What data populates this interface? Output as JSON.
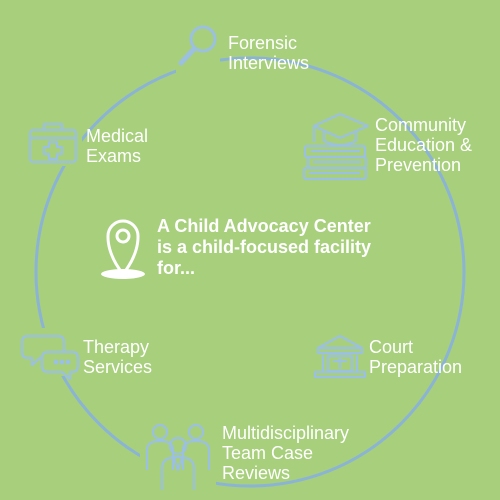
{
  "center": {
    "text": "A Child Advocacy Center\nis a child-focused facility\nfor...",
    "icon": "location-pin-icon"
  },
  "nodes": [
    {
      "id": "forensic-interviews",
      "label": "Forensic\nInterviews",
      "icon": "magnifying-glass-icon"
    },
    {
      "id": "community-education",
      "label": "Community\nEducation &\nPrevention",
      "icon": "graduation-cap-books-icon"
    },
    {
      "id": "court-preparation",
      "label": "Court\nPreparation",
      "icon": "courthouse-icon"
    },
    {
      "id": "multidisciplinary-team",
      "label": "Multidisciplinary\nTeam Case\nReviews",
      "icon": "team-people-icon"
    },
    {
      "id": "therapy-services",
      "label": "Therapy\nServices",
      "icon": "speech-bubbles-icon"
    },
    {
      "id": "medical-exams",
      "label": "Medical\nExams",
      "icon": "medical-kit-icon"
    }
  ],
  "colors": {
    "background": "#a7cf7c",
    "ring": "#8bb3d6",
    "icon_stroke": "#9cc0e0",
    "text": "#ffffff"
  }
}
